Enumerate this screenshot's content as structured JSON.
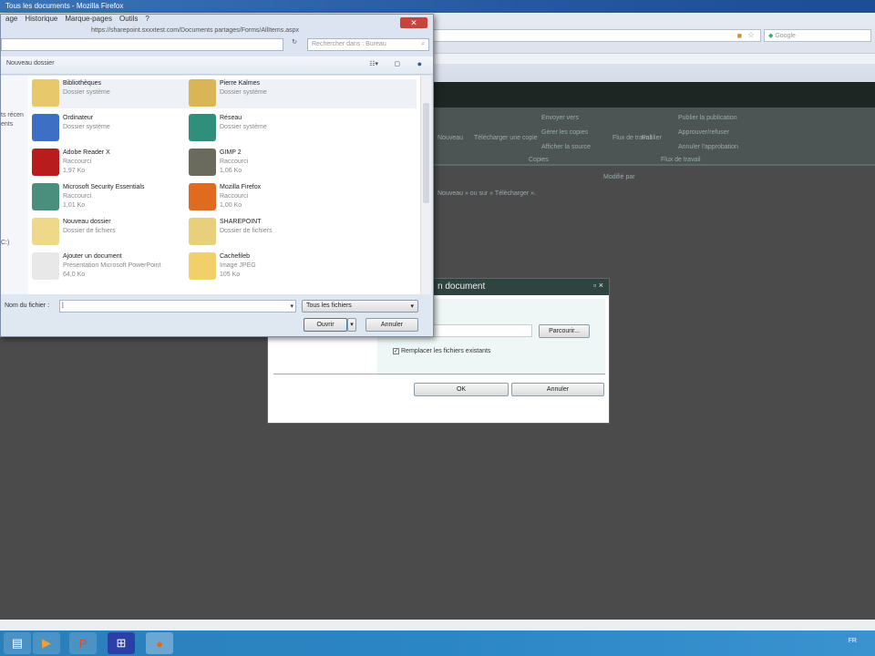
{
  "browser": {
    "title": "Tous les documents - Mozilla Firefox",
    "menu": [
      "age",
      "Historique",
      "Marque-pages",
      "Outils",
      "?"
    ],
    "url": "https://sharepoint.sxxxtest.com/Documents partages/Forms/AllItems.aspx",
    "search_placeholder": "Google"
  },
  "sharepoint": {
    "ribbon": {
      "items": [
        "Nouveau",
        "Télécharger une copie",
        "Envoyer vers",
        "Gérer les copies",
        "Afficher la source",
        "Flux de travail",
        "Publier",
        "Publier la publication",
        "Approuver/refuser",
        "Annuler l'approbation"
      ],
      "groups": [
        "Copies",
        "Flux de travail"
      ]
    },
    "column_header": "Modifié par",
    "hint": "Nouveau » ou sur « Télécharger »."
  },
  "file_dialog": {
    "search_placeholder": "Rechercher dans : Bureau",
    "new_folder": "Nouveau dossier",
    "nav": [
      "ts récen",
      "ents",
      "C:)"
    ],
    "items": [
      {
        "name": "Bibliothèques",
        "type": "Dossier système",
        "size": "",
        "icon": "library-icon",
        "color": "#e7c86a"
      },
      {
        "name": "Pierre Kalmes",
        "type": "Dossier système",
        "size": "",
        "icon": "user-folder-icon",
        "color": "#d9b558"
      },
      {
        "name": "Ordinateur",
        "type": "Dossier système",
        "size": "",
        "icon": "computer-icon",
        "color": "#3d6fc4"
      },
      {
        "name": "Réseau",
        "type": "Dossier système",
        "size": "",
        "icon": "network-icon",
        "color": "#2f8f7a"
      },
      {
        "name": "Adobe Reader X",
        "type": "Raccourci",
        "size": "1,97 Ko",
        "icon": "adobe-reader-icon",
        "color": "#b81c1c"
      },
      {
        "name": "GIMP 2",
        "type": "Raccourci",
        "size": "1,06 Ko",
        "icon": "gimp-icon",
        "color": "#6b6b5d"
      },
      {
        "name": "Microsoft Security Essentials",
        "type": "Raccourci",
        "size": "1,01 Ko",
        "icon": "security-essentials-icon",
        "color": "#4a8f7e"
      },
      {
        "name": "Mozilla Firefox",
        "type": "Raccourci",
        "size": "1,00 Ko",
        "icon": "firefox-icon",
        "color": "#e06b1f"
      },
      {
        "name": "Nouveau dossier",
        "type": "Dossier de fichiers",
        "size": "",
        "icon": "folder-icon",
        "color": "#efd88a"
      },
      {
        "name": "SHAREPOINT",
        "type": "Dossier de fichiers",
        "size": "",
        "icon": "folder-icon",
        "color": "#e8cf7c"
      },
      {
        "name": "Ajouter un document",
        "type": "Présentation Microsoft PowerPoint",
        "size": "64,0 Ko",
        "icon": "powerpoint-file-icon",
        "color": "#e8e8e8"
      },
      {
        "name": "Cachefileb",
        "type": "Image JPEG",
        "size": "105 Ko",
        "icon": "jpeg-file-icon",
        "color": "#f1cf6a"
      }
    ],
    "filename_label": "Nom du fichier :",
    "filename_value": "",
    "filter": "Tous les fichiers",
    "open": "Ouvrir",
    "cancel": "Annuler"
  },
  "upload_dialog": {
    "title": "n document",
    "browse": "Parcourir...",
    "overwrite_label": "Remplacer les fichiers existants",
    "overwrite_checked": true,
    "ok": "OK",
    "cancel": "Annuler"
  },
  "taskbar": {
    "tray": "FR"
  }
}
